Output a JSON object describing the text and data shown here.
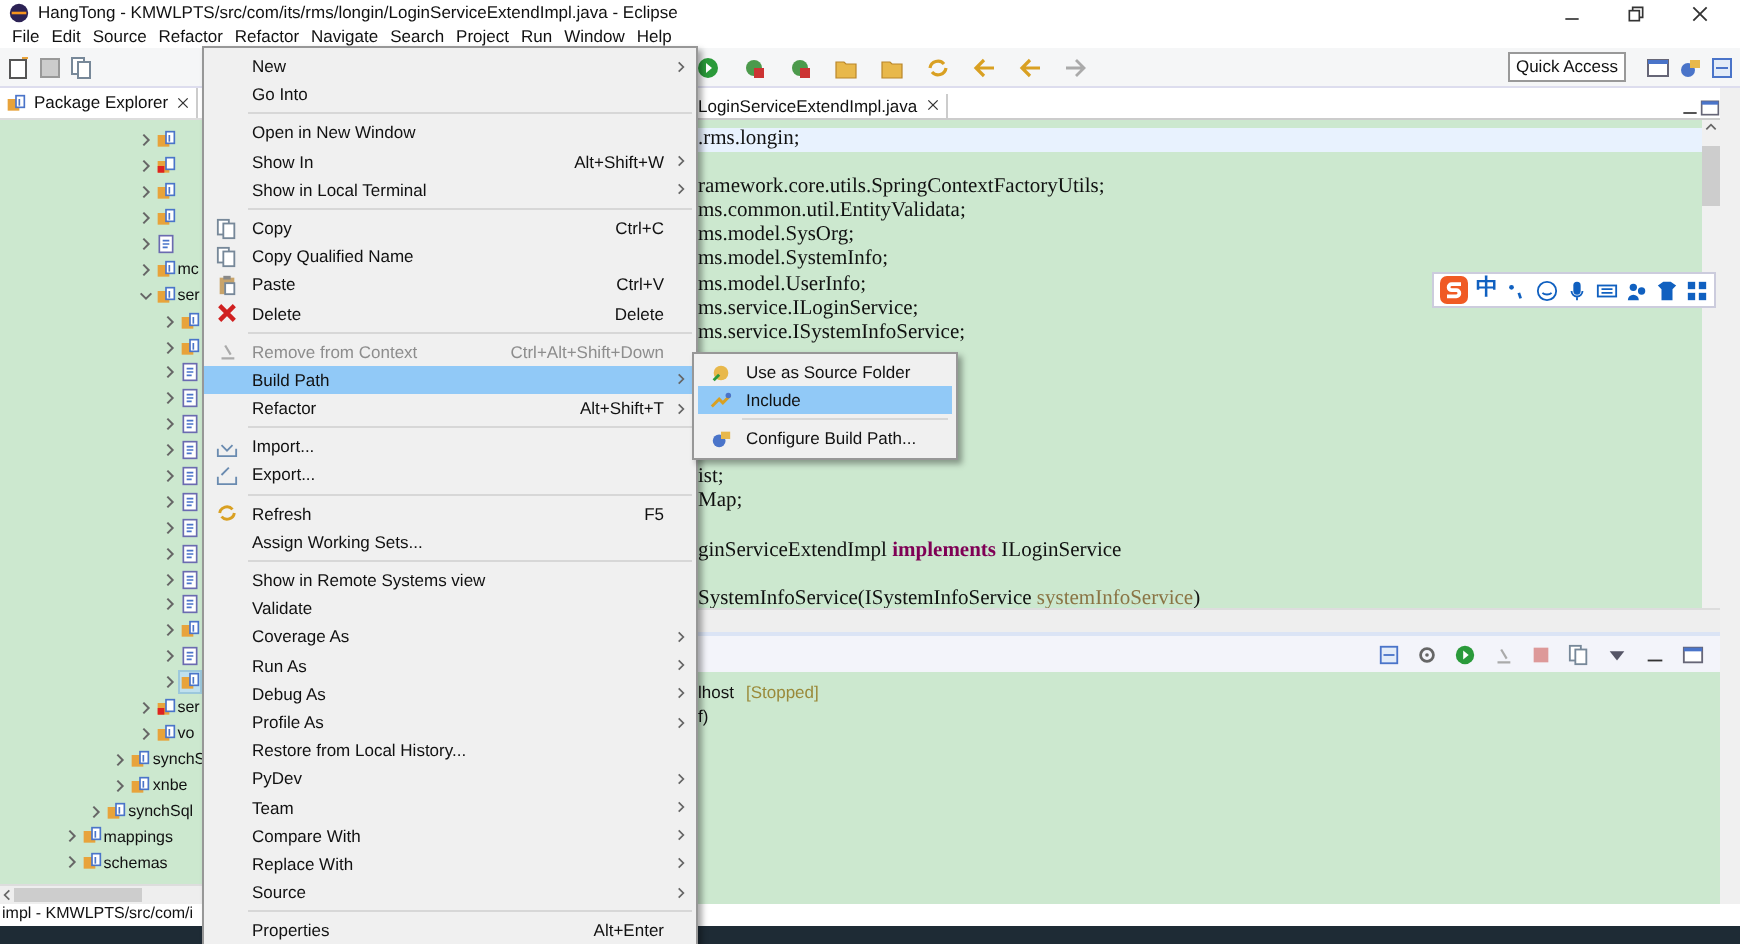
{
  "window": {
    "title": "HangTong - KMWLPTS/src/com/its/rms/longin/LoginServiceExtendImpl.java - Eclipse"
  },
  "menu_bar": [
    "File",
    "Edit",
    "Source",
    "Refactor",
    "Refactor",
    "Navigate",
    "Search",
    "Project",
    "Run",
    "Window",
    "Help"
  ],
  "toolbar": {
    "quick_access": "Quick Access"
  },
  "package_explorer": {
    "title": "Package Explorer",
    "tree": [
      {
        "children": [
          {
            "label": "mappings",
            "kind": "package",
            "expanded": false,
            "selected": false
          },
          {
            "label": "schemas",
            "kind": "package",
            "expanded": false,
            "selected": false
          }
        ],
        "lead": [
          {
            "children": [
              {
                "label": "synchSql",
                "kind": "package",
                "expanded": false,
                "selected": false
              }
            ],
            "lead": [
              {
                "children": [
                  {
                    "label": "synchS",
                    "kind": "package",
                    "expanded": false,
                    "selected": false
                  },
                  {
                    "label": "xnbe",
                    "kind": "package",
                    "expanded": false,
                    "selected": false
                  }
                ],
                "lead": [
                  {
                    "children": [
                      {
                        "kind": "package",
                        "expanded": false,
                        "selected": false
                      },
                      {
                        "kind": "package-error",
                        "expanded": false,
                        "selected": false
                      },
                      {
                        "kind": "package",
                        "expanded": false,
                        "selected": false
                      },
                      {
                        "kind": "package",
                        "expanded": false,
                        "selected": false
                      },
                      {
                        "kind": "file",
                        "expanded": false,
                        "selected": false
                      },
                      {
                        "label": "mc",
                        "kind": "package",
                        "expanded": false,
                        "selected": false
                      },
                      {
                        "label": "ser",
                        "kind": "package",
                        "expanded": true,
                        "selected": false,
                        "children": [
                          {
                            "kind": "package",
                            "expanded": false,
                            "selected": false
                          },
                          {
                            "kind": "package",
                            "expanded": false,
                            "selected": false
                          },
                          {
                            "kind": "file",
                            "expanded": false,
                            "selected": false
                          },
                          {
                            "kind": "file",
                            "expanded": false,
                            "selected": false
                          },
                          {
                            "kind": "file",
                            "expanded": false,
                            "selected": false
                          },
                          {
                            "kind": "file",
                            "expanded": false,
                            "selected": false
                          },
                          {
                            "kind": "file",
                            "expanded": false,
                            "selected": false
                          },
                          {
                            "kind": "file",
                            "expanded": false,
                            "selected": false
                          },
                          {
                            "kind": "file",
                            "expanded": false,
                            "selected": false
                          },
                          {
                            "kind": "file",
                            "expanded": false,
                            "selected": false
                          },
                          {
                            "kind": "file",
                            "expanded": false,
                            "selected": false
                          },
                          {
                            "kind": "file",
                            "expanded": false,
                            "selected": false
                          },
                          {
                            "kind": "package",
                            "expanded": false,
                            "selected": false
                          },
                          {
                            "kind": "file",
                            "expanded": false,
                            "selected": false
                          },
                          {
                            "kind": "package",
                            "expanded": false,
                            "selected": true
                          }
                        ]
                      },
                      {
                        "label": "ser",
                        "kind": "package-error",
                        "expanded": false,
                        "selected": false
                      },
                      {
                        "label": "vo",
                        "kind": "package",
                        "expanded": false,
                        "selected": false
                      }
                    ]
                  }
                ]
              }
            ]
          }
        ]
      }
    ]
  },
  "context_menu": [
    {
      "kind": "item",
      "label": "New",
      "submenu": true,
      "disabled": false,
      "selected": false
    },
    {
      "kind": "item",
      "label": "Go Into",
      "submenu": false,
      "disabled": false,
      "selected": false
    },
    {
      "kind": "separator"
    },
    {
      "kind": "item",
      "label": "Open in New Window",
      "submenu": false,
      "disabled": false,
      "selected": false
    },
    {
      "kind": "item",
      "label": "Show In",
      "shortcut": "Alt+Shift+W",
      "submenu": true,
      "disabled": false,
      "selected": false
    },
    {
      "kind": "item",
      "label": "Show in Local Terminal",
      "submenu": true,
      "disabled": false,
      "selected": false
    },
    {
      "kind": "separator"
    },
    {
      "kind": "item",
      "label": "Copy",
      "shortcut": "Ctrl+C",
      "submenu": false,
      "disabled": false,
      "selected": false
    },
    {
      "kind": "item",
      "label": "Copy Qualified Name",
      "submenu": false,
      "disabled": false,
      "selected": false
    },
    {
      "kind": "item",
      "label": "Paste",
      "shortcut": "Ctrl+V",
      "submenu": false,
      "disabled": false,
      "selected": false
    },
    {
      "kind": "item",
      "label": "Delete",
      "shortcut": "Delete",
      "submenu": false,
      "disabled": false,
      "selected": false
    },
    {
      "kind": "separator"
    },
    {
      "kind": "item",
      "label": "Remove from Context",
      "shortcut": "Ctrl+Alt+Shift+Down",
      "submenu": false,
      "disabled": true,
      "selected": false
    },
    {
      "kind": "item",
      "label": "Build Path",
      "submenu": true,
      "disabled": false,
      "selected": true
    },
    {
      "kind": "item",
      "label": "Refactor",
      "shortcut": "Alt+Shift+T",
      "submenu": true,
      "disabled": false,
      "selected": false
    },
    {
      "kind": "separator"
    },
    {
      "kind": "item",
      "label": "Import...",
      "submenu": false,
      "disabled": false,
      "selected": false
    },
    {
      "kind": "item",
      "label": "Export...",
      "submenu": false,
      "disabled": false,
      "selected": false
    },
    {
      "kind": "separator"
    },
    {
      "kind": "item",
      "label": "Refresh",
      "shortcut": "F5",
      "submenu": false,
      "disabled": false,
      "selected": false
    },
    {
      "kind": "item",
      "label": "Assign Working Sets...",
      "submenu": false,
      "disabled": false,
      "selected": false
    },
    {
      "kind": "separator"
    },
    {
      "kind": "item",
      "label": "Show in Remote Systems view",
      "submenu": false,
      "disabled": false,
      "selected": false
    },
    {
      "kind": "item",
      "label": "Validate",
      "submenu": false,
      "disabled": false,
      "selected": false
    },
    {
      "kind": "item",
      "label": "Coverage As",
      "submenu": true,
      "disabled": false,
      "selected": false
    },
    {
      "kind": "item",
      "label": "Run As",
      "submenu": true,
      "disabled": false,
      "selected": false
    },
    {
      "kind": "item",
      "label": "Debug As",
      "submenu": true,
      "disabled": false,
      "selected": false
    },
    {
      "kind": "item",
      "label": "Profile As",
      "submenu": true,
      "disabled": false,
      "selected": false
    },
    {
      "kind": "item",
      "label": "Restore from Local History...",
      "submenu": false,
      "disabled": false,
      "selected": false
    },
    {
      "kind": "item",
      "label": "PyDev",
      "submenu": true,
      "disabled": false,
      "selected": false
    },
    {
      "kind": "item",
      "label": "Team",
      "submenu": true,
      "disabled": false,
      "selected": false
    },
    {
      "kind": "item",
      "label": "Compare With",
      "submenu": true,
      "disabled": false,
      "selected": false
    },
    {
      "kind": "item",
      "label": "Replace With",
      "submenu": true,
      "disabled": false,
      "selected": false
    },
    {
      "kind": "item",
      "label": "Source",
      "submenu": true,
      "disabled": false,
      "selected": false
    },
    {
      "kind": "separator"
    },
    {
      "kind": "item",
      "label": "Properties",
      "shortcut": "Alt+Enter",
      "submenu": false,
      "disabled": false,
      "selected": false
    }
  ],
  "build_path_submenu": [
    {
      "kind": "item",
      "label": "Use as Source Folder",
      "selected": false
    },
    {
      "kind": "item",
      "label": "Include",
      "selected": true
    },
    {
      "kind": "separator"
    },
    {
      "kind": "item",
      "label": "Configure Build Path...",
      "selected": false
    }
  ],
  "editor": {
    "tab": "LoginServiceExtendImpl.java",
    "blocks": [
      [
        [
          {
            "text": ".rms.longin;",
            "kind": "plain"
          }
        ]
      ],
      [
        [
          {
            "text": "ramework.core.utils.SpringContextFactoryUtils;",
            "kind": "plain"
          }
        ],
        [
          {
            "text": "ms.common.util.EntityValidata;",
            "kind": "plain"
          }
        ],
        [
          {
            "text": "ms.model.SysOrg;",
            "kind": "plain"
          }
        ],
        [
          {
            "text": "ms.model.SystemInfo;",
            "kind": "plain"
          }
        ],
        [
          {
            "text": "ms.model.UserInfo;",
            "kind": "plain"
          }
        ],
        [
          {
            "text": "ms.service.ILoginService;",
            "kind": "plain"
          }
        ],
        [
          {
            "text": "ms.service.ISystemInfoService;",
            "kind": "plain"
          }
        ]
      ],
      [
        [
          {
            "text": "ist;",
            "kind": "plain"
          }
        ],
        [
          {
            "text": "Map;",
            "kind": "plain"
          }
        ]
      ],
      [
        [
          {
            "text": "ginServiceExtendImpl ",
            "kind": "plain"
          },
          {
            "text": "implements",
            "kind": "keyword"
          },
          {
            "text": " ILoginService",
            "kind": "plain"
          }
        ]
      ],
      [
        [
          {
            "text": "SystemInfoService(ISystemInfoService ",
            "kind": "plain"
          },
          {
            "text": "systemInfoService",
            "kind": "parameter"
          },
          {
            "text": ")",
            "kind": "plain"
          }
        ]
      ]
    ]
  },
  "ime_toolbar": {
    "mode": "中"
  },
  "servers_panel": {
    "lines": [
      [
        {
          "text": "lhost",
          "kind": "plain"
        },
        {
          "text": "[Stopped]",
          "kind": "status"
        }
      ],
      [
        {
          "text": "f)",
          "kind": "plain"
        }
      ]
    ]
  },
  "status_bar": "impl - KMWLPTS/src/com/i"
}
